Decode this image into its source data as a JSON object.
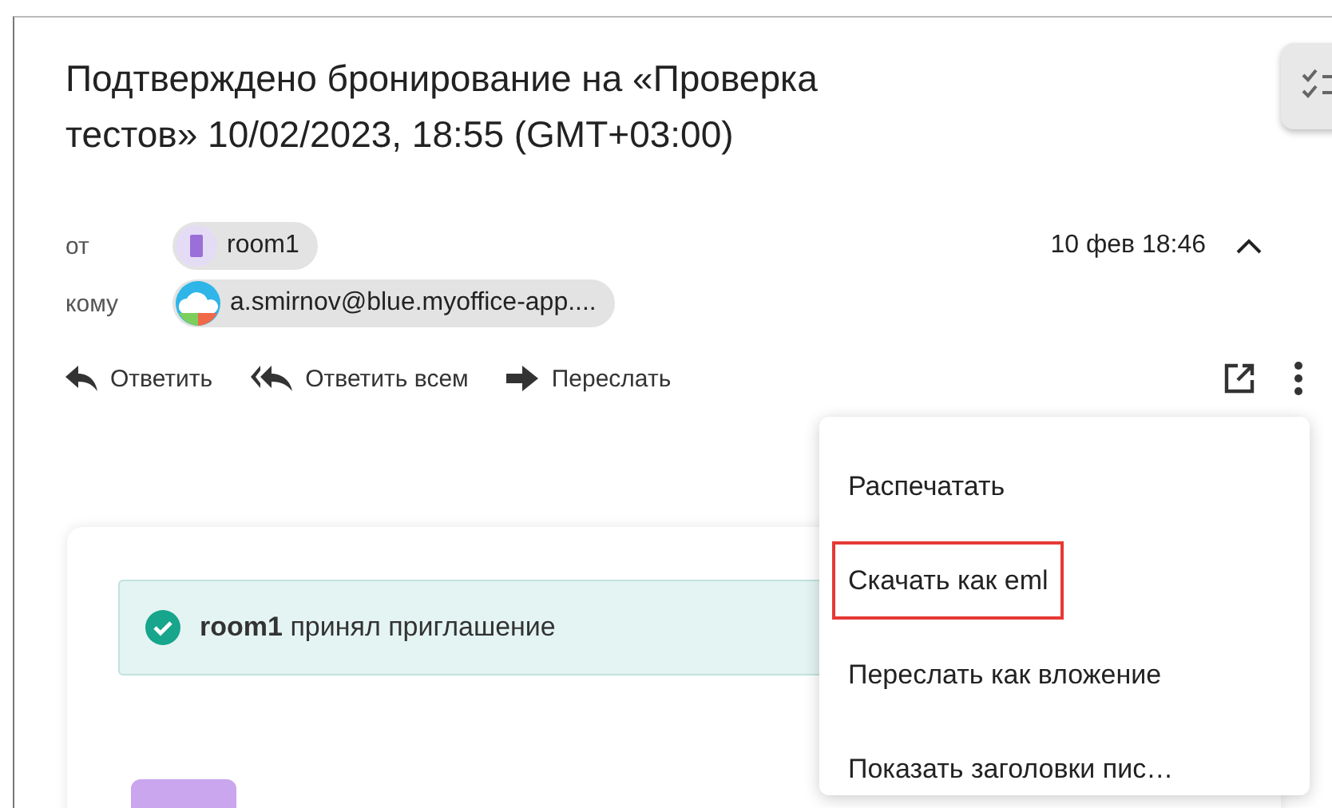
{
  "title": "Подтверждено бронирование на «Проверка тестов» 10/02/2023, 18:55 (GMT+03:00)",
  "from": {
    "label": "от",
    "name": "room1"
  },
  "to": {
    "label": "кому",
    "address": "a.smirnov@blue.myoffice-app...."
  },
  "date": "10 фев 18:46",
  "header_expanded": true,
  "actions": [
    {
      "kind": "reply",
      "label": "Ответить"
    },
    {
      "kind": "reply-all",
      "label": "Ответить всем"
    },
    {
      "kind": "forward",
      "label": "Переслать"
    }
  ],
  "menu": [
    {
      "label": "Распечатать",
      "highlighted": false
    },
    {
      "label": "Скачать как eml",
      "highlighted": true
    },
    {
      "label": "Переслать как вложение",
      "highlighted": false
    },
    {
      "label": "Показать заголовки пис…",
      "highlighted": false
    }
  ],
  "banner": {
    "text": "**room1** принял приглашение"
  }
}
